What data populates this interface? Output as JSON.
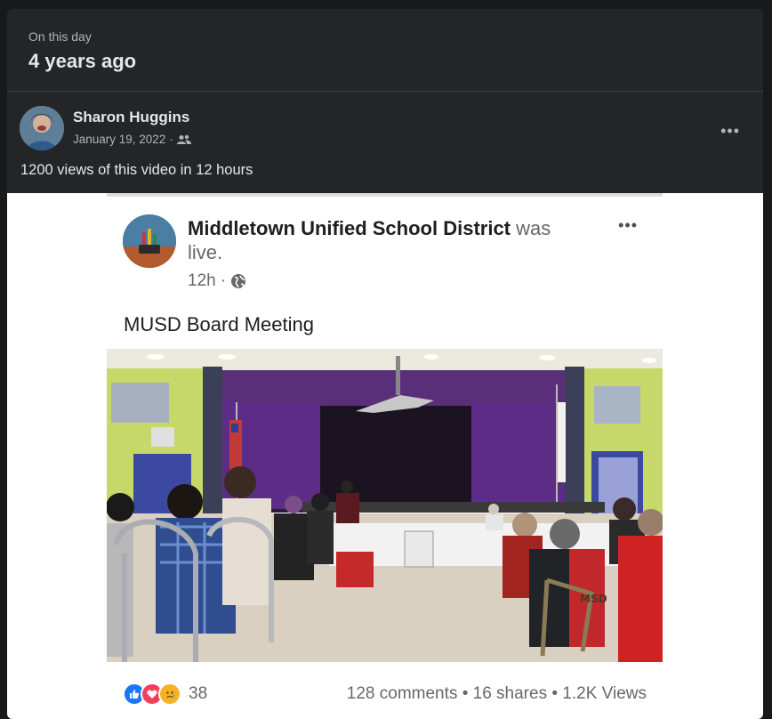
{
  "memory": {
    "kicker": "On this day",
    "title": "4 years ago"
  },
  "post": {
    "author": "Sharon Huggins",
    "date": "January 19, 2022",
    "separator": "·",
    "audience_icon": "friends-icon",
    "caption": "1200 views of this video in 12 hours",
    "more_icon": "•••"
  },
  "shared_post": {
    "page_name": "Middletown Unified School District",
    "live_text": "was live.",
    "time": "12h",
    "separator": "·",
    "audience_icon": "globe-icon",
    "more_icon": "•••",
    "text": "MUSD Board Meeting",
    "reaction_count": "38",
    "comments": "128 comments",
    "shares": "16 shares",
    "views": "1.2K Views",
    "stat_separator": "•",
    "chair_text": "MSD"
  },
  "colors": {
    "card_bg": "#242526",
    "page_bg": "#18191a",
    "text_primary": "#e4e6eb",
    "text_secondary": "#b0b3b8",
    "like_blue": "#1877f2",
    "love_red": "#f33e58",
    "sad_yellow": "#f7b125"
  }
}
